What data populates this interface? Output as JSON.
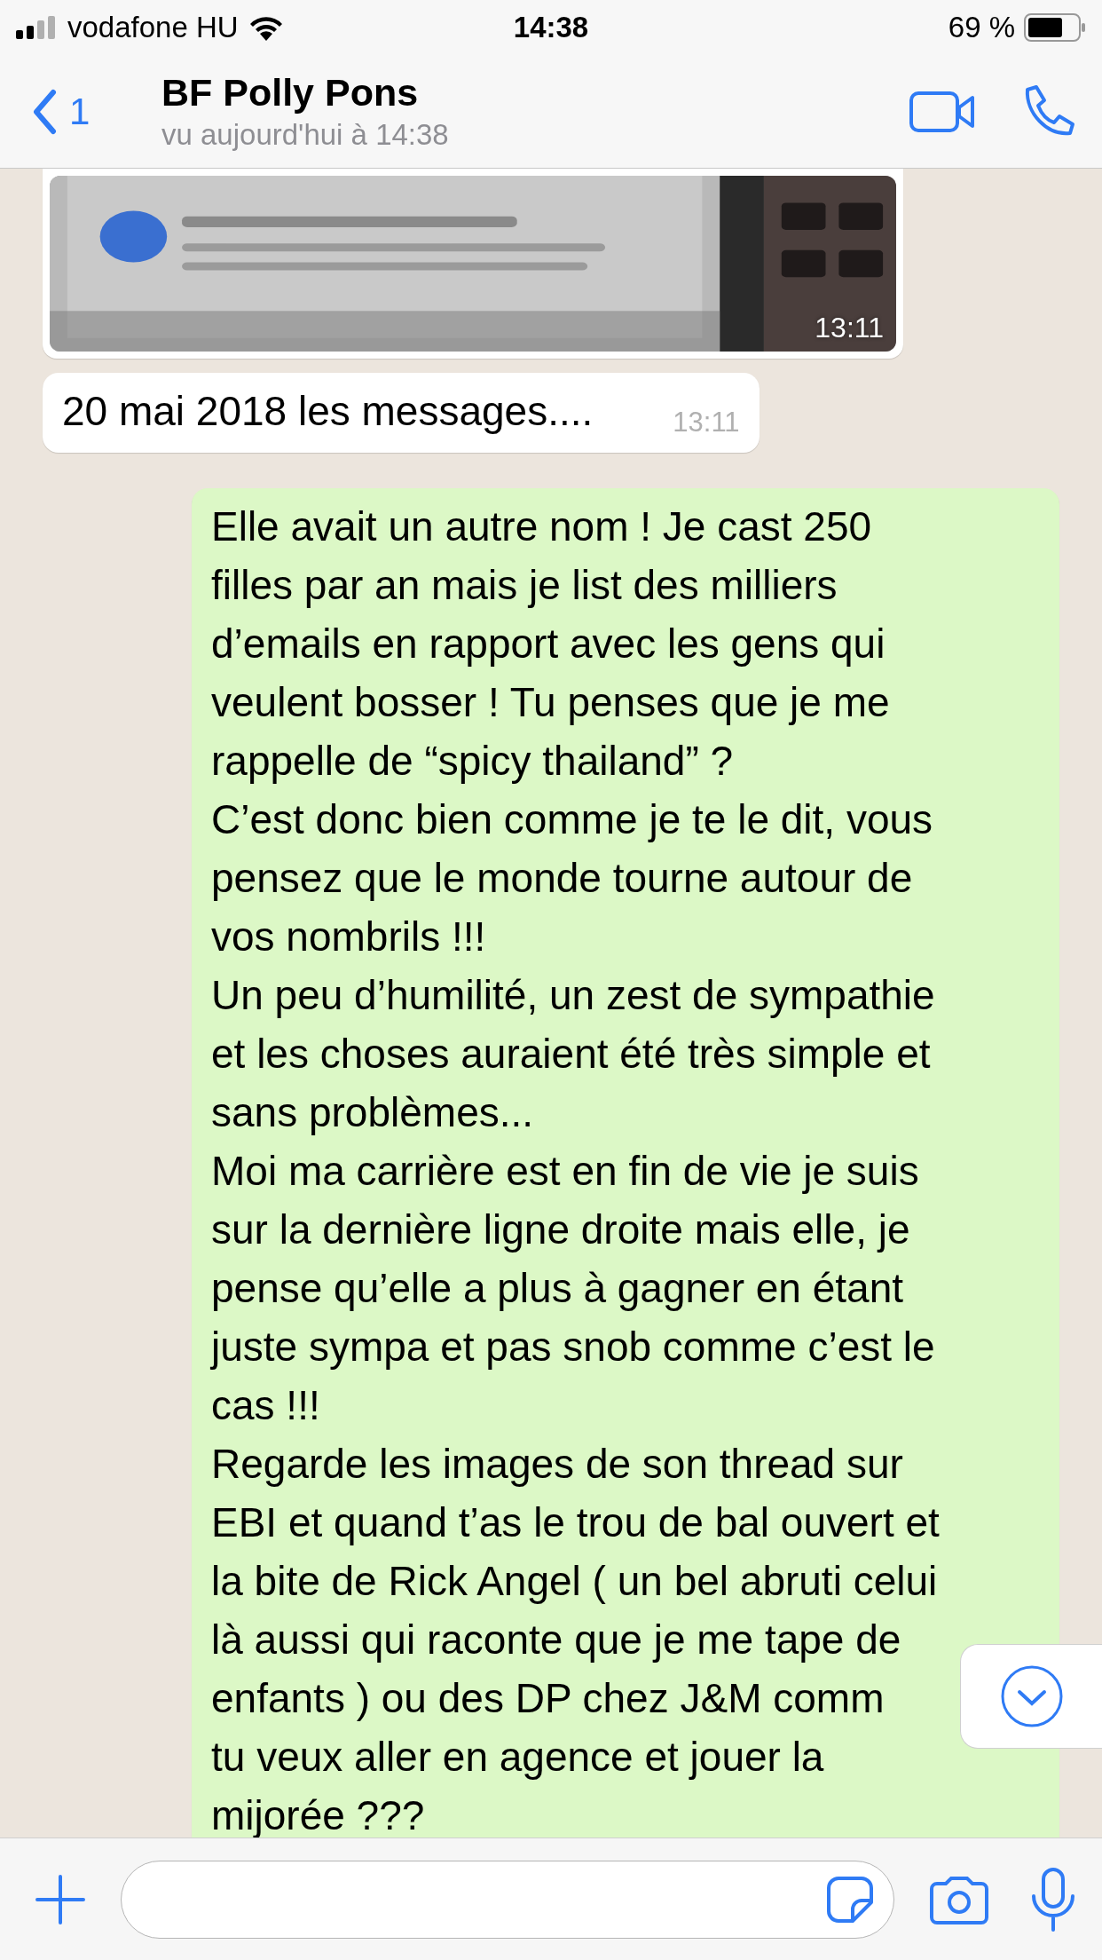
{
  "status_bar": {
    "carrier": "vodafone HU",
    "time": "14:38",
    "battery": "69 %"
  },
  "header": {
    "back_count": "1",
    "title": "BF Polly Pons",
    "subtitle": "vu aujourd'hui à 14:38"
  },
  "messages": [
    {
      "outgoing": false,
      "time": "13:11"
    },
    {
      "kind": "text",
      "outgoing": false,
      "lines": [
        "20 mai 2018 les messages...."
      ],
      "time": "13:11"
    },
    {
      "kind": "text",
      "outgoing": true,
      "lines": [
        "Elle avait un autre nom ! Je cast 250",
        "filles par an mais je list des milliers",
        "d’emails en rapport avec les gens qui",
        "veulent bosser ! Tu penses que je me",
        "rappelle de “spicy thailand” ?",
        "C’est donc bien comme je te le dit, vous",
        "pensez que le monde tourne autour de",
        "vos nombrils !!!",
        "Un peu d’humilité, un zest de sympathie",
        "et les choses auraient été très simple et",
        "sans problèmes...",
        "Moi ma carrière est en fin de vie je suis",
        "sur la dernière ligne droite mais elle, je",
        "pense qu’elle a plus à gagner en étant",
        "juste sympa et pas snob comme c’est le",
        "cas !!!",
        "Regarde les images de son thread sur",
        "EBI et quand t’as le trou de bal ouvert et",
        "la bite de Rick Angel ( un bel abruti celui",
        "là aussi qui raconte que je me tape de",
        "enfants ) ou des DP chez J&M comm",
        "tu veux aller en agence et jouer la",
        "mijorée ???"
      ]
    }
  ]
}
